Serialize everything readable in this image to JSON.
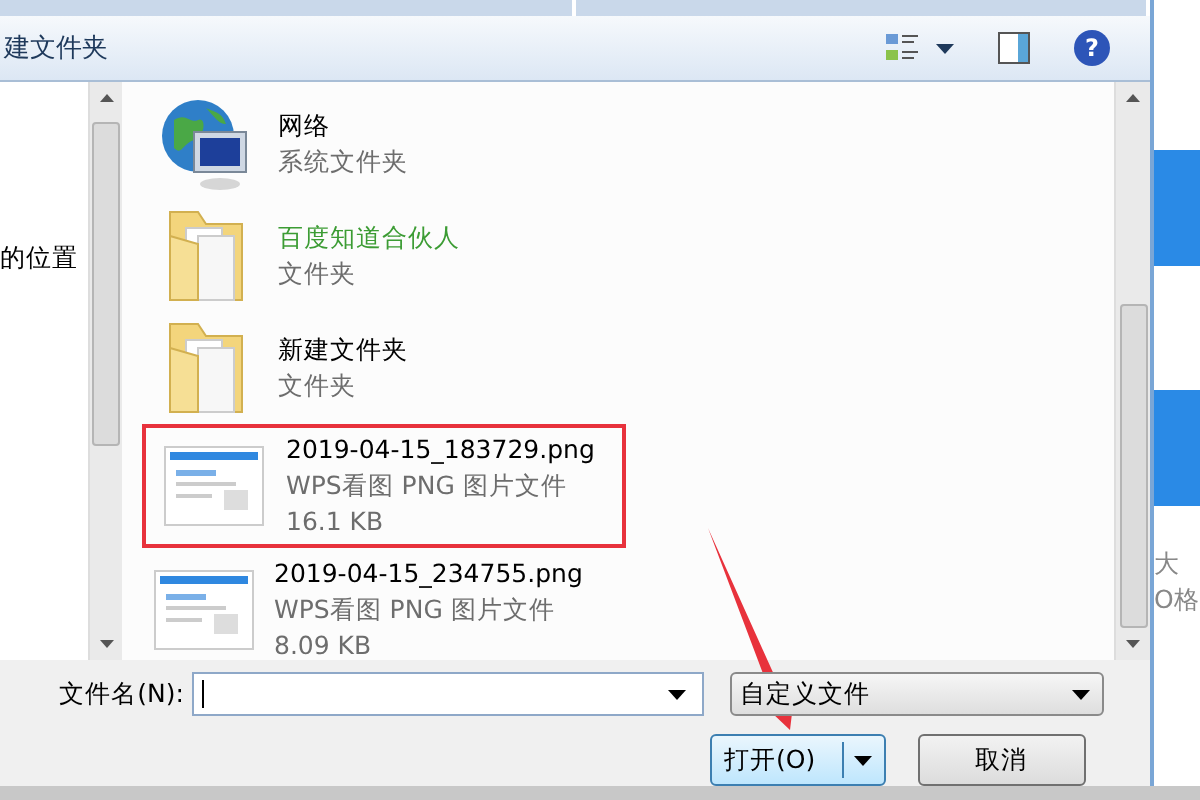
{
  "toolbar": {
    "title": "建文件夹",
    "help": "?"
  },
  "nav_pane": {
    "items": [
      {
        "label": "的位置"
      }
    ]
  },
  "files": [
    {
      "kind": "network",
      "name": "网络",
      "type": "系统文件夹",
      "color": "#000000",
      "highlighted": false
    },
    {
      "kind": "folder",
      "name": "百度知道合伙人",
      "type": "文件夹",
      "color": "#3c9c34",
      "highlighted": false
    },
    {
      "kind": "folder",
      "name": "新建文件夹",
      "type": "文件夹",
      "color": "#000000",
      "highlighted": false
    },
    {
      "kind": "image",
      "name": "2019-04-15_183729.png",
      "type": "WPS看图 PNG 图片文件",
      "size": "16.1 KB",
      "color": "#000000",
      "highlighted": true
    },
    {
      "kind": "image",
      "name": "2019-04-15_234755.png",
      "type": "WPS看图 PNG 图片文件",
      "size": "8.09 KB",
      "color": "#000000",
      "highlighted": false
    }
  ],
  "bottom": {
    "filename_label": "文件名(N):",
    "file_type": "自定义文件",
    "buttons": [
      {
        "label": "打开(O)",
        "kind": "split"
      },
      {
        "label": "取消",
        "kind": "plain"
      }
    ]
  },
  "background_page": {
    "texts": [
      "大",
      "O格"
    ]
  }
}
